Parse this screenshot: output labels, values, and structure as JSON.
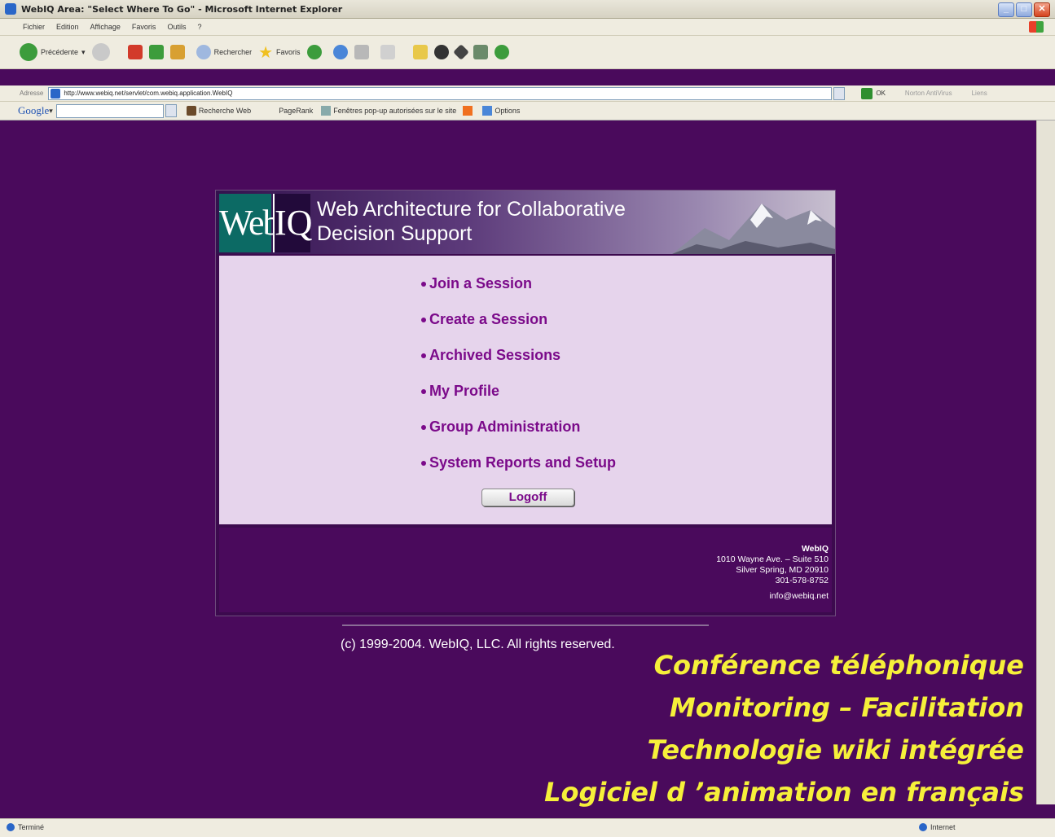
{
  "window": {
    "title": "WebIQ Area: \"Select Where To Go\" - Microsoft Internet Explorer"
  },
  "menubar": {
    "items": [
      "Fichier",
      "Edition",
      "Affichage",
      "Favoris",
      "Outils",
      "?"
    ]
  },
  "toolbar": {
    "back_label": "Précédente",
    "search_label": "Rechercher",
    "favorites_label": "Favoris"
  },
  "address": {
    "label": "Adresse",
    "url": "http://www.webiq.net/servlet/com.webiq.application.WebIQ",
    "go_label": "OK",
    "norton_label": "Norton AntiVirus",
    "links_label": "Liens"
  },
  "googlebar": {
    "logo": "Google",
    "search_web_label": "Recherche Web",
    "pagerank_label": "PageRank",
    "popup_label": "Fenêtres pop-up autorisées sur le site",
    "options_label": "Options"
  },
  "banner": {
    "logo_web": "Web",
    "logo_iq": "IQ",
    "title_line1": "Web Architecture for Collaborative",
    "title_line2": "Decision Support"
  },
  "menu": {
    "items": [
      "Join a Session",
      "Create a Session",
      "Archived Sessions",
      "My Profile",
      "Group Administration",
      "System Reports and Setup"
    ],
    "logoff_label": "Logoff"
  },
  "contact": {
    "company": "WebIQ",
    "street": "1010 Wayne Ave. – Suite 510",
    "city": "Silver Spring, MD 20910",
    "phone": "301-578-8752",
    "email": "info@webiq.net"
  },
  "copyright": "(c) 1999-2004. WebIQ, LLC. All rights reserved.",
  "overlay": {
    "lines": [
      "Conférence téléphonique",
      "Monitoring – Facilitation",
      "Technologie wiki intégrée",
      "Logiciel d ’animation en français"
    ]
  },
  "status": {
    "left": "Terminé",
    "right": "Internet"
  },
  "colors": {
    "page_bg": "#4a0a5c",
    "menu_bg": "#e6d4ec",
    "link": "#7b0a8a",
    "overlay_text": "#f6f03a"
  }
}
